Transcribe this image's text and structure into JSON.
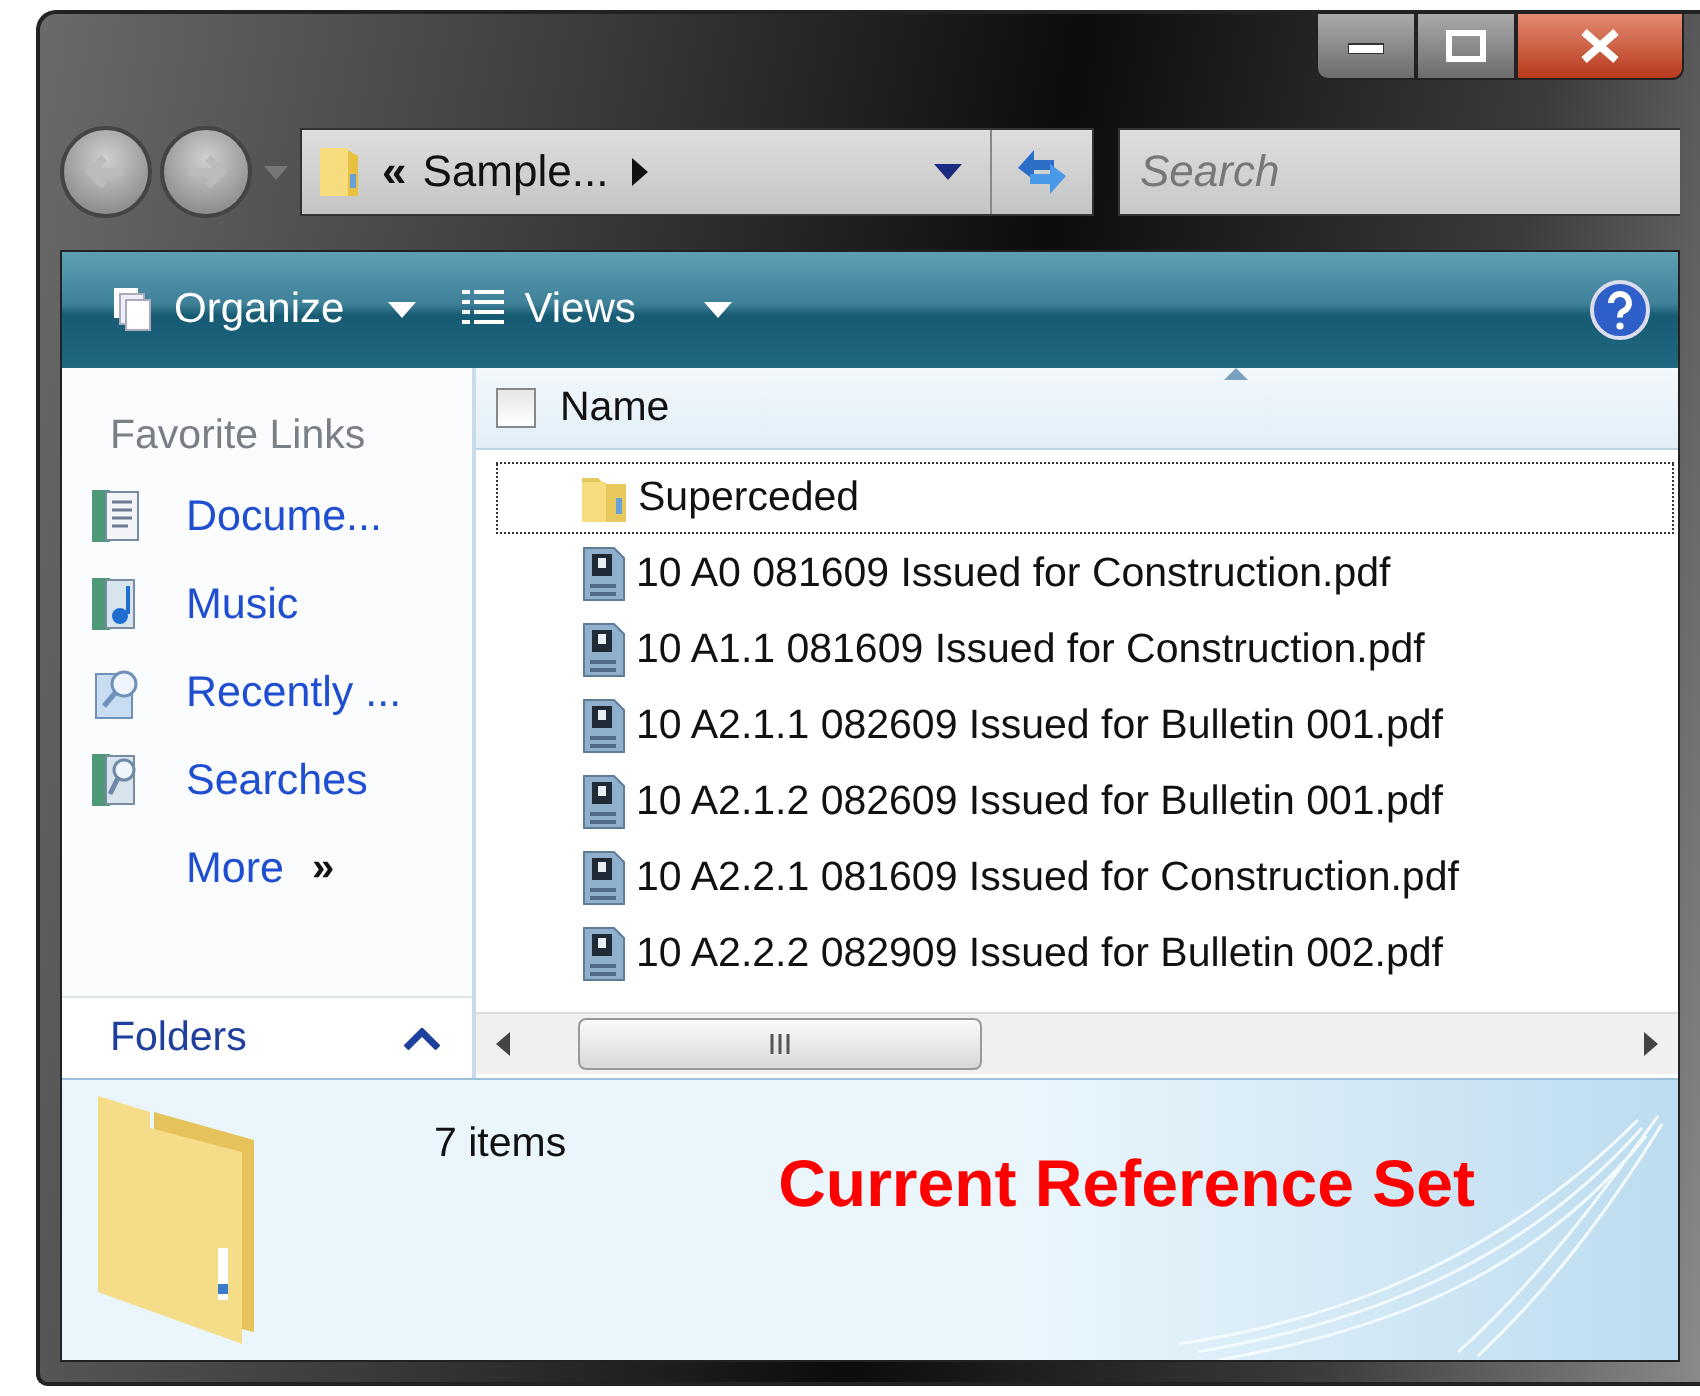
{
  "address": {
    "prefix": "«",
    "text": "Sample..."
  },
  "search": {
    "placeholder": "Search"
  },
  "toolbar": {
    "buttons": [
      {
        "label": "Organize",
        "kind": "organize"
      },
      {
        "label": "Views",
        "kind": "views"
      }
    ]
  },
  "sidebar": {
    "heading": "Favorite Links",
    "links": [
      {
        "label": "Docume...",
        "kind": "documents"
      },
      {
        "label": "Music",
        "kind": "music"
      },
      {
        "label": "Recently ...",
        "kind": "recent"
      },
      {
        "label": "Searches",
        "kind": "searches"
      }
    ],
    "more": {
      "label": "More",
      "glyph": "»"
    },
    "folders": {
      "label": "Folders"
    }
  },
  "file_list": {
    "header_checkbox": {
      "checked": false
    },
    "columns": [
      {
        "label": "Name"
      }
    ],
    "rows": [
      {
        "kind": "folder",
        "name": "Superceded",
        "focused": true
      },
      {
        "kind": "pdf",
        "name": "10 A0 081609 Issued for Construction.pdf",
        "focused": false
      },
      {
        "kind": "pdf",
        "name": "10 A1.1 081609 Issued for Construction.pdf",
        "focused": false
      },
      {
        "kind": "pdf",
        "name": "10 A2.1.1 082609 Issued for Bulletin 001.pdf",
        "focused": false
      },
      {
        "kind": "pdf",
        "name": "10 A2.1.2 082609 Issued for Bulletin 001.pdf",
        "focused": false
      },
      {
        "kind": "pdf",
        "name": "10 A2.2.1 081609 Issued for Construction.pdf",
        "focused": false
      },
      {
        "kind": "pdf",
        "name": "10 A2.2.2 082909 Issued for Bulletin 002.pdf",
        "focused": false
      }
    ]
  },
  "details": {
    "count": "7 items",
    "note": "Current Reference Set"
  }
}
